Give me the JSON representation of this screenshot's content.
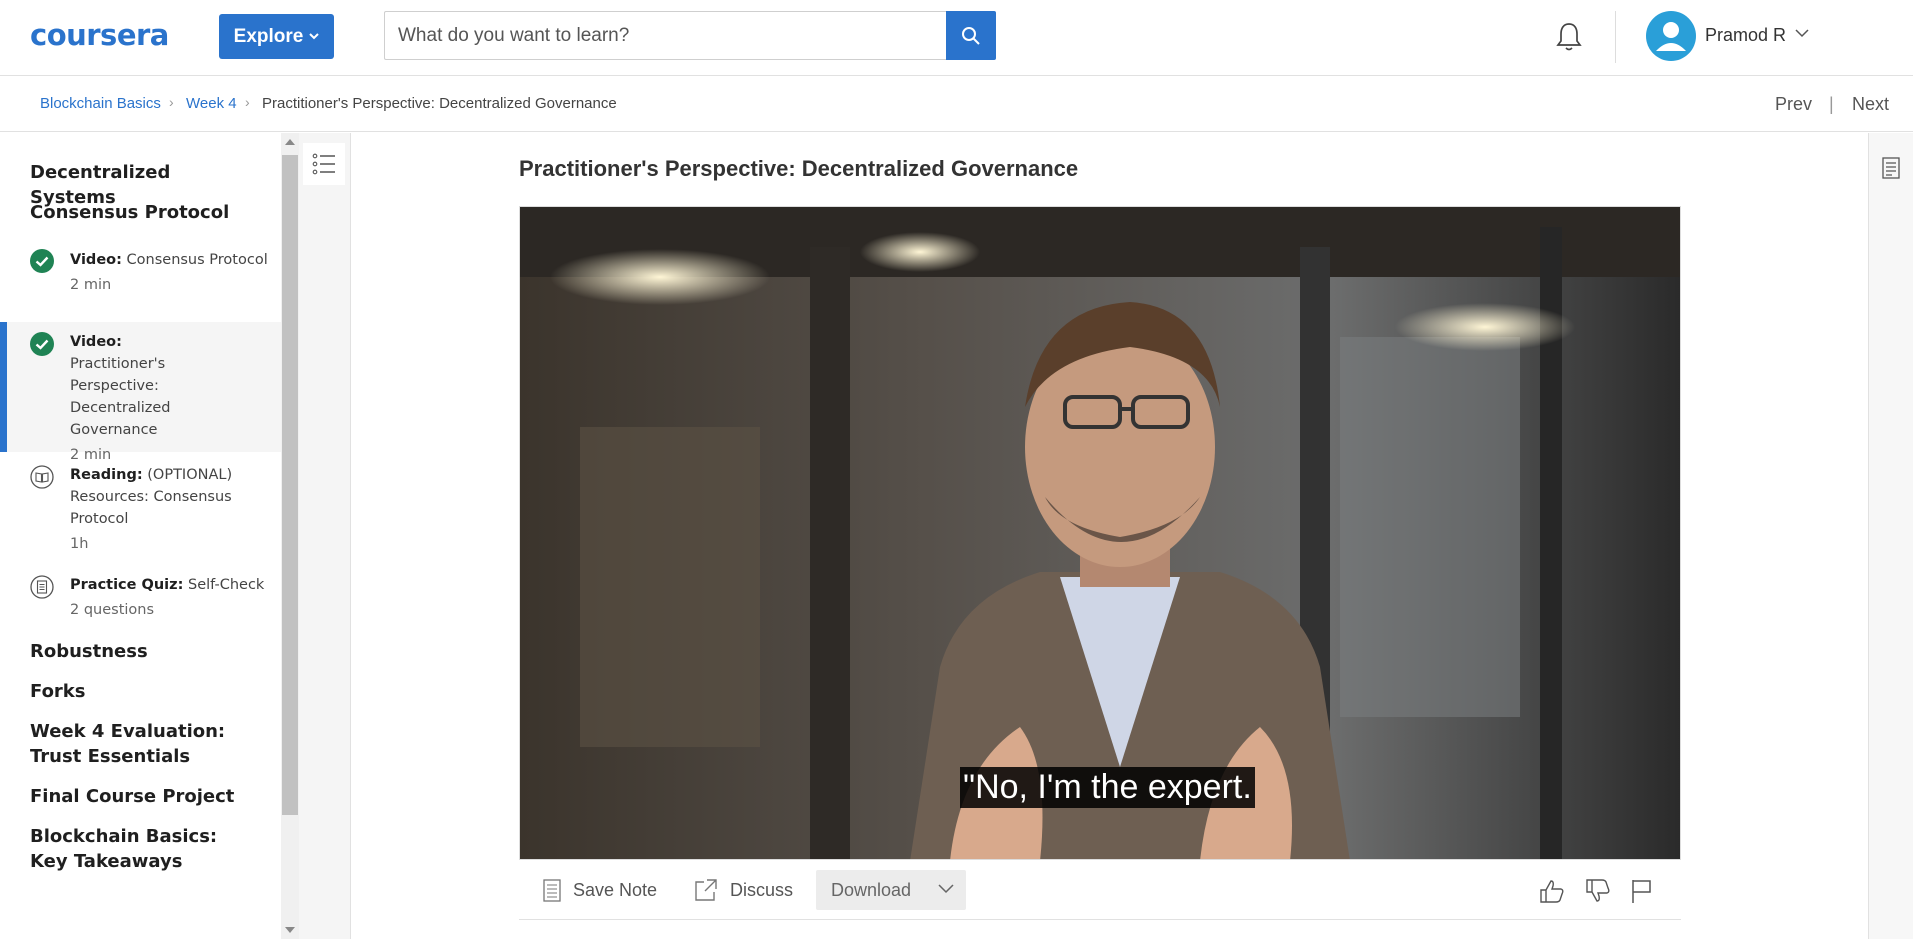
{
  "header": {
    "logo_text": "coursera",
    "explore_label": "Explore",
    "search_placeholder": "What do you want to learn?",
    "user_name": "Pramod R",
    "accent_color": "#2a73cc"
  },
  "breadcrumb": {
    "items": [
      "Blockchain Basics",
      "Week 4",
      "Practitioner's Perspective: Decentralized Governance"
    ],
    "prev_label": "Prev",
    "divider": "|",
    "next_label": "Next"
  },
  "sidebar": {
    "modules_before": [
      "Decentralized Systems",
      "Consensus Protocol"
    ],
    "items": [
      {
        "type_label": "Video:",
        "title": "Consensus Protocol",
        "meta": "2 min",
        "icon": "check-circle-icon",
        "status": "completed"
      },
      {
        "type_label": "Video:",
        "title": "Practitioner's Perspective: Decentralized Governance",
        "meta": "2 min",
        "icon": "check-circle-icon",
        "status": "completed-active"
      },
      {
        "type_label": "Reading:",
        "title": "(OPTIONAL) Resources: Consensus Protocol",
        "meta": "1h",
        "icon": "book-icon",
        "status": "not-started"
      },
      {
        "type_label": "Practice Quiz:",
        "title": "Self-Check",
        "meta": "2 questions",
        "icon": "quiz-icon",
        "status": "not-started"
      }
    ],
    "modules_after": [
      "Robustness",
      "Forks",
      "Week 4 Evaluation: Trust Essentials",
      "Final Course Project",
      "Blockchain Basics: Key Takeaways"
    ]
  },
  "main": {
    "title": "Practitioner's Perspective: Decentralized Governance",
    "caption": "\"No, I'm the expert."
  },
  "toolbar": {
    "save_note_label": "Save Note",
    "discuss_label": "Discuss",
    "download_label": "Download",
    "icons": [
      "notes-icon",
      "external-link-icon",
      "chevron-down-icon",
      "thumbs-up-icon",
      "thumbs-down-icon",
      "flag-icon"
    ]
  }
}
